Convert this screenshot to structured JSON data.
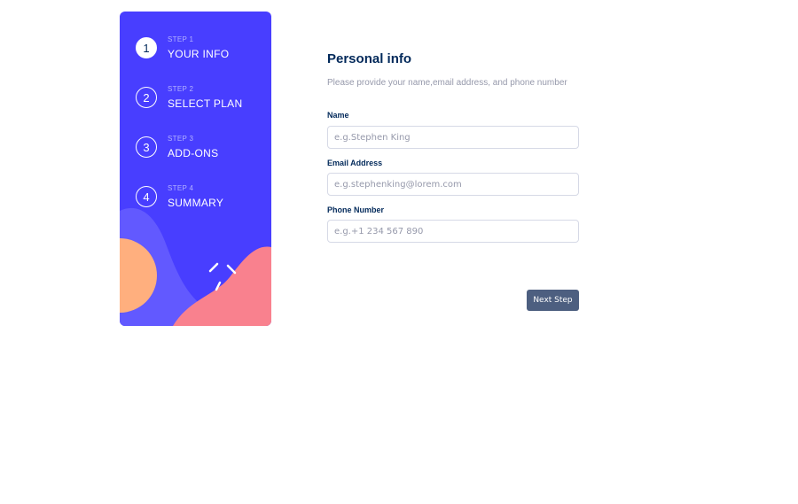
{
  "sidebar": {
    "colors": {
      "background": "#483eff",
      "orange_blob": "#ffaf7e",
      "pink_blob": "#f9818e",
      "purple_blob": "#6259ff"
    },
    "steps": [
      {
        "number": "1",
        "label": "STEP 1",
        "title": "YOUR INFO",
        "active": true
      },
      {
        "number": "2",
        "label": "STEP 2",
        "title": "SELECT PLAN",
        "active": false
      },
      {
        "number": "3",
        "label": "STEP 3",
        "title": "ADD-ONS",
        "active": false
      },
      {
        "number": "4",
        "label": "STEP 4",
        "title": "SUMMARY",
        "active": false
      }
    ]
  },
  "form": {
    "title": "Personal info",
    "description": "Please provide your name,email address, and phone number",
    "fields": {
      "name": {
        "label": "Name",
        "placeholder": "e.g.Stephen King",
        "value": ""
      },
      "email": {
        "label": "Email Address",
        "placeholder": "e.g.stephenking@lorem.com",
        "value": ""
      },
      "phone": {
        "label": "Phone Number",
        "placeholder": "e.g.+1 234 567 890",
        "value": ""
      }
    },
    "next_label": "Next Step"
  }
}
